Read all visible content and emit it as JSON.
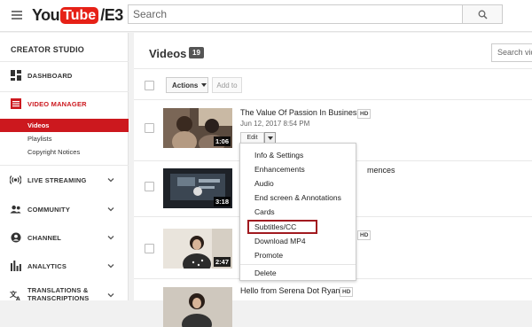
{
  "header": {
    "logo_you": "You",
    "logo_tube": "Tube",
    "logo_suffix": "/E3",
    "search_placeholder": "Search"
  },
  "sidebar": {
    "title": "CREATOR STUDIO",
    "dashboard": "DASHBOARD",
    "video_manager": "VIDEO MANAGER",
    "sub_items": [
      "Videos",
      "Playlists",
      "Copyright Notices"
    ],
    "live_streaming": "LIVE STREAMING",
    "community": "COMMUNITY",
    "channel": "CHANNEL",
    "analytics": "ANALYTICS",
    "translations": "TRANSLATIONS &",
    "transcriptions": "TRANSCRIPTIONS"
  },
  "main": {
    "title": "Videos",
    "count": "19",
    "search_placeholder": "Search videos",
    "actions_label": "Actions",
    "add_to_label": "Add to",
    "edit_label": "Edit",
    "videos": [
      {
        "title": "The Value Of Passion In Business",
        "badge": "HD",
        "date": "Jun 12, 2017 8:54 PM",
        "duration": "1:06"
      },
      {
        "title": "mences",
        "duration": "3:18"
      },
      {
        "badge": "HD",
        "duration": "2:47"
      },
      {
        "title": "Hello from Serena Dot Ryan",
        "badge": "HD"
      }
    ],
    "menu_items": [
      "Info & Settings",
      "Enhancements",
      "Audio",
      "End screen & Annotations",
      "Cards",
      "Subtitles/CC",
      "Download MP4",
      "Promote",
      "Delete"
    ]
  },
  "colors": {
    "brand_red": "#cc181e",
    "highlight_box": "#a11a1f"
  }
}
